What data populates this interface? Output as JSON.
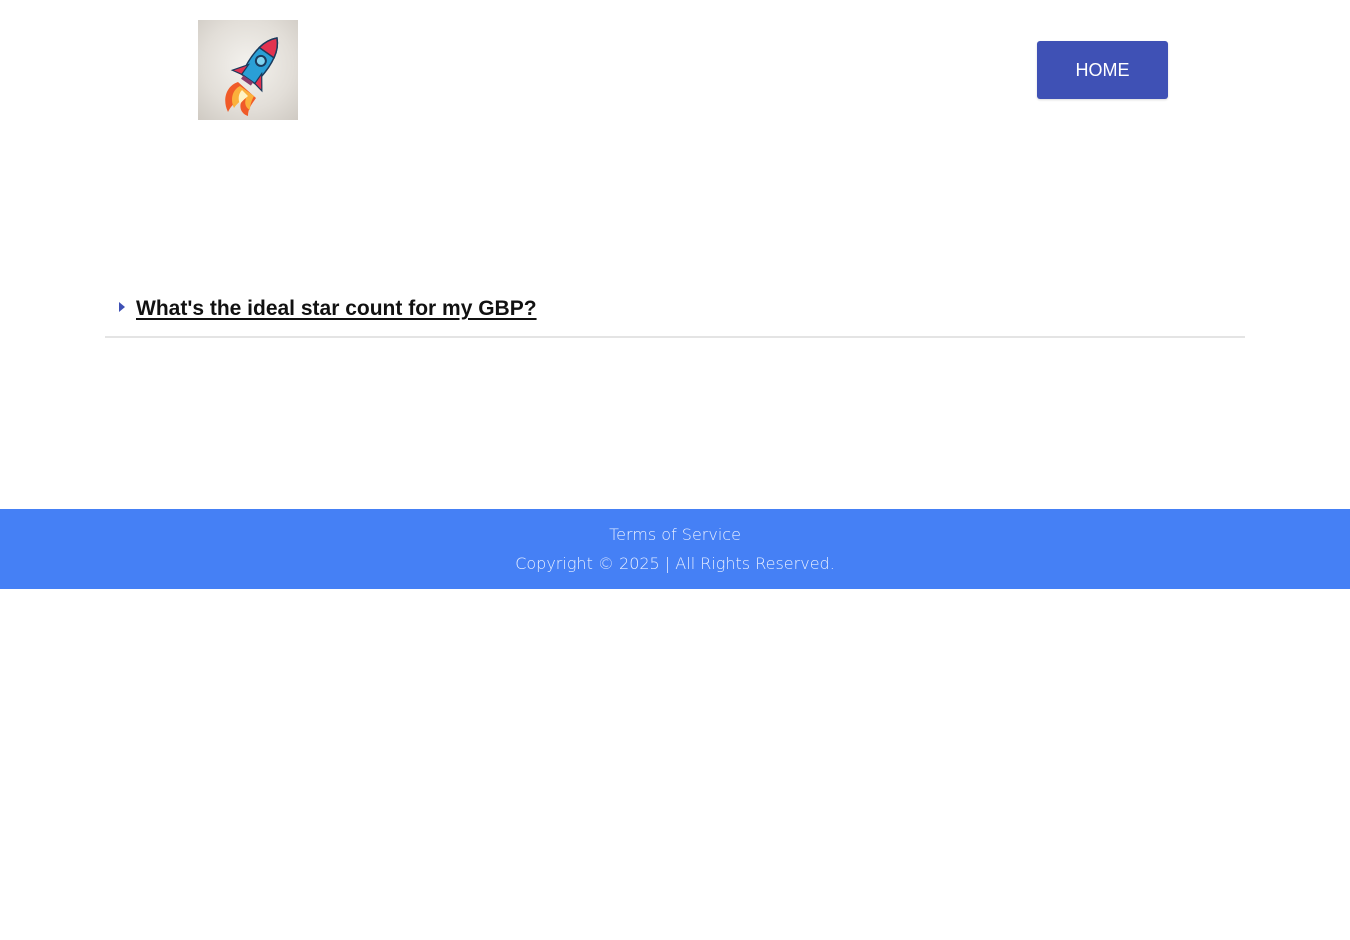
{
  "header": {
    "logo_icon": "rocket-icon",
    "nav": {
      "home_label": "HOME"
    }
  },
  "faq": {
    "items": [
      {
        "question": "What's the ideal star count for my GBP?",
        "expanded": false
      }
    ]
  },
  "footer": {
    "terms_label": "Terms of Service",
    "copyright": "Copyright © 2025 | All Rights Reserved."
  },
  "colors": {
    "primary": "#3f51b5",
    "footer_bg": "#4580f5",
    "footer_text": "#e8efff"
  }
}
